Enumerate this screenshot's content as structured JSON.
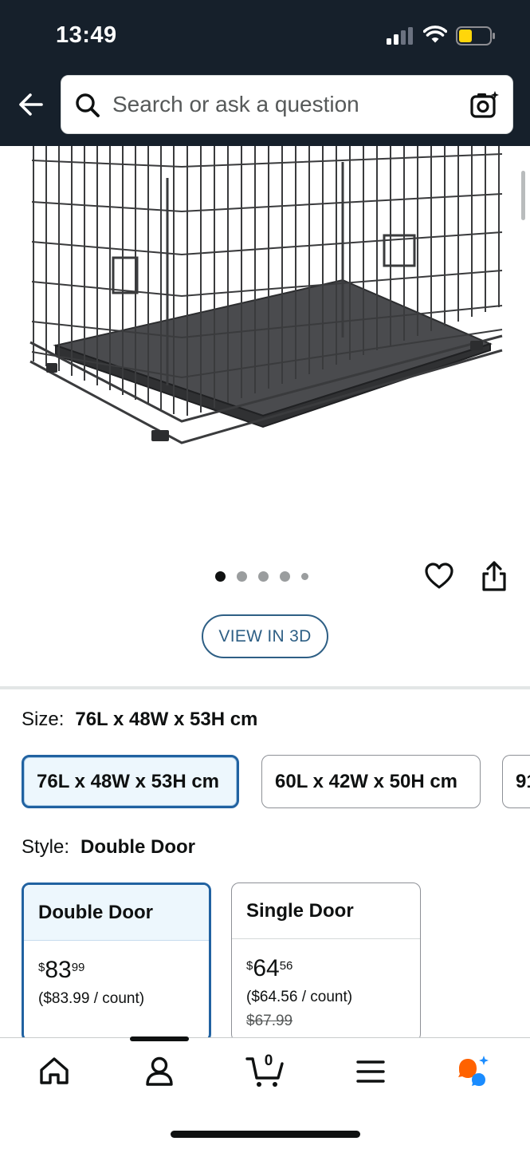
{
  "status_bar": {
    "time": "13:49"
  },
  "search": {
    "placeholder": "Search or ask a question"
  },
  "carousel": {
    "total_images": 5,
    "active_index": 0
  },
  "view_3d": {
    "label": "VIEW IN 3D"
  },
  "size": {
    "label": "Size:",
    "selected": "76L x 48W x 53H cm",
    "options": [
      "76L x 48W x 53H cm",
      "60L x 42W x 50H cm",
      "91"
    ]
  },
  "style": {
    "label": "Style:",
    "selected": "Double Door",
    "options": [
      {
        "name": "Double Door",
        "currency": "$",
        "whole": "83",
        "fraction": "99",
        "per_count": "($83.99 / count)",
        "old_price": ""
      },
      {
        "name": "Single Door",
        "currency": "$",
        "whole": "64",
        "fraction": "56",
        "per_count": "($64.56 / count)",
        "old_price": "$67.99"
      }
    ]
  },
  "bottom_nav": {
    "items": [
      "home",
      "account",
      "cart",
      "menu",
      "rufus"
    ],
    "cart_count": "0",
    "active": "account"
  },
  "colors": {
    "header_bg": "#16202b",
    "selected_border": "#2162a1",
    "selected_bg": "#edf7fd",
    "link_blue": "#2e5f85",
    "rufus_orange": "#ff6200",
    "rufus_blue": "#1a8cff",
    "battery_yellow": "#ffd60a"
  }
}
